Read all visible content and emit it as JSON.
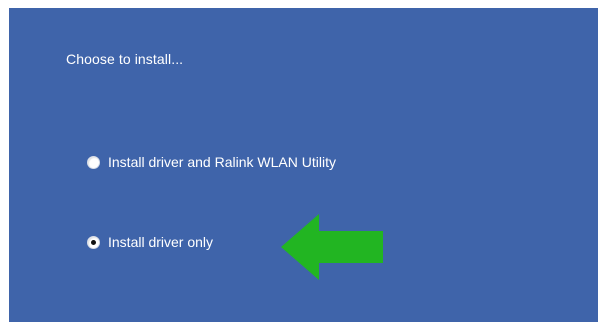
{
  "installer": {
    "prompt": "Choose to install...",
    "options": [
      {
        "label": "Install driver and Ralink WLAN Utility",
        "selected": false
      },
      {
        "label": "Install driver only",
        "selected": true
      }
    ],
    "background_color": "#3f64aa",
    "arrow_color": "#22b522",
    "arrow_icon": "green-arrow-left-icon"
  }
}
